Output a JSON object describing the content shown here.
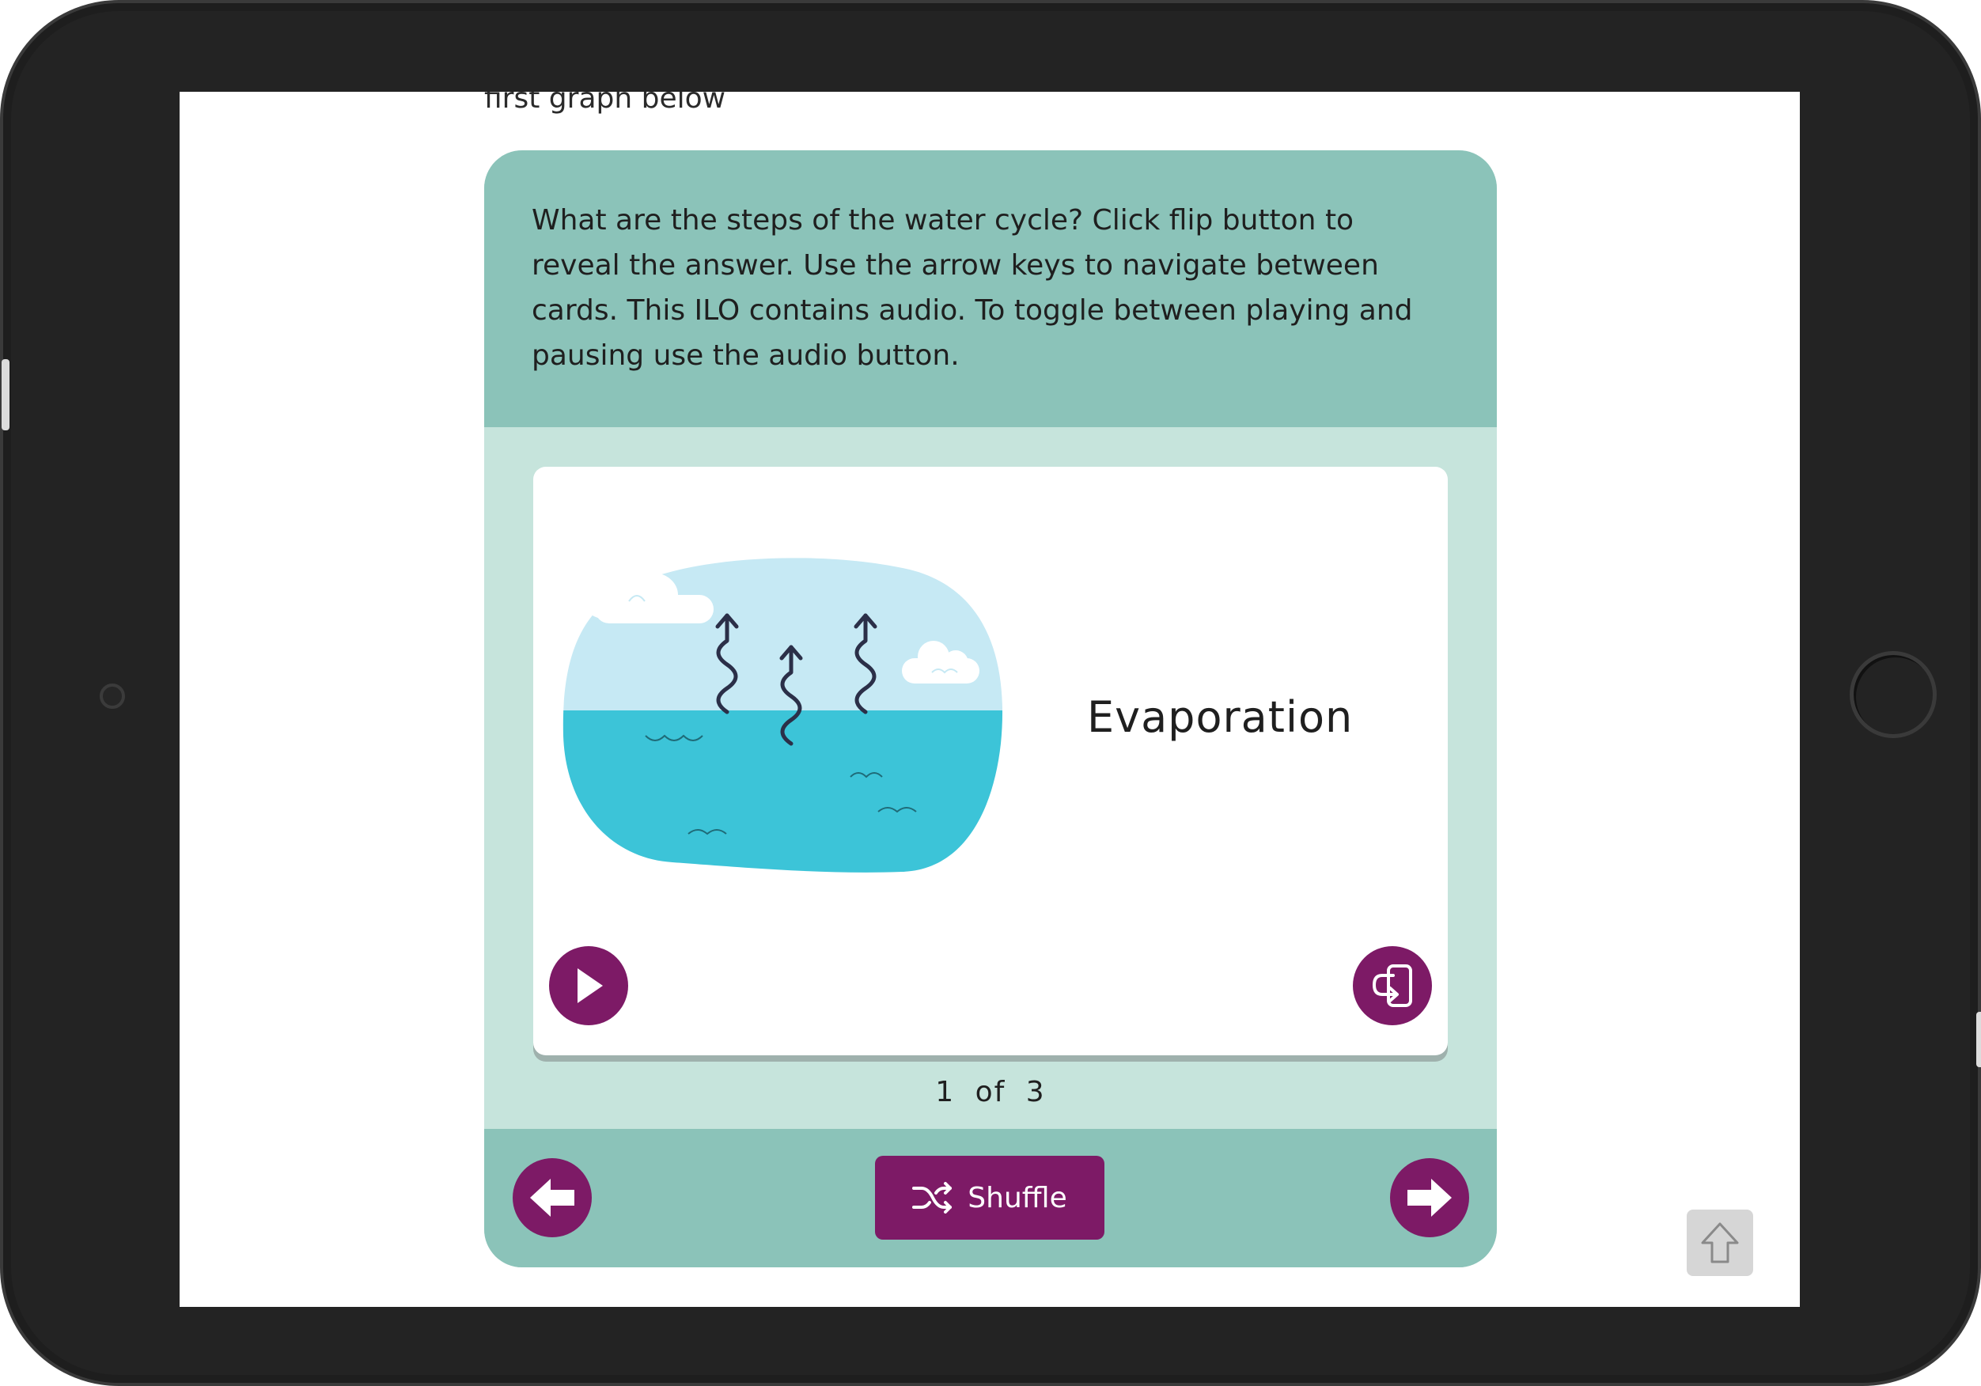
{
  "page": {
    "intro_text": "first graph below"
  },
  "ilo": {
    "instructions": "What are the steps of the water cycle? Click flip button to reveal the answer. Use the arrow keys to navigate between cards. This ILO contains audio. To toggle between playing and pausing use the audio button.",
    "card": {
      "title": "Evaporation",
      "illustration_icon": "evaporation-illustration",
      "audio_icon": "play-icon",
      "flip_icon": "flip-card-icon"
    },
    "counter": {
      "current": "1",
      "of_label": "of",
      "total": "3"
    },
    "footer": {
      "prev_icon": "arrow-left-icon",
      "next_icon": "arrow-right-icon",
      "shuffle_label": "Shuffle",
      "shuffle_icon": "shuffle-icon"
    }
  },
  "colors": {
    "accent": "#7d1a66",
    "panel_dark": "#8bc3b9",
    "panel_light": "#c6e4dc",
    "water": "#3cc4d8",
    "sky": "#c6e9f4"
  },
  "scroll_top_icon": "arrow-up-icon"
}
